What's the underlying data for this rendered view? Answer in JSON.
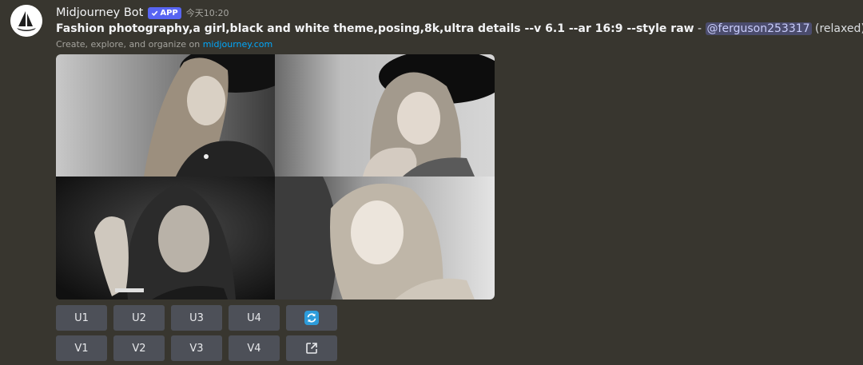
{
  "message": {
    "author": "Midjourney Bot",
    "badge": "APP",
    "timestamp": "今天10:20",
    "prompt": "Fashion photography,a girl,black and white theme,posing,8k,ultra details --v 6.1 --ar 16:9 --style raw",
    "separator": " - ",
    "mention": "@ferguson253317",
    "mode": "(relaxed)",
    "subtext_prefix": "Create, explore, and organize on ",
    "subtext_link": "midjourney.com"
  },
  "image_grid": {
    "images": [
      {
        "icon": "photo-girl-hat-denim"
      },
      {
        "icon": "photo-girl-hat-hand-chin"
      },
      {
        "icon": "photo-girl-hand-hair"
      },
      {
        "icon": "photo-girl-blonde-denim"
      }
    ]
  },
  "buttons": {
    "row1": [
      {
        "label": "U1"
      },
      {
        "label": "U2"
      },
      {
        "label": "U3"
      },
      {
        "label": "U4"
      },
      {
        "icon": "reroll-icon",
        "color": "#2d9cdb"
      }
    ],
    "row2": [
      {
        "label": "V1"
      },
      {
        "label": "V2"
      },
      {
        "label": "V3"
      },
      {
        "label": "V4"
      },
      {
        "icon": "external-link-icon"
      }
    ]
  }
}
